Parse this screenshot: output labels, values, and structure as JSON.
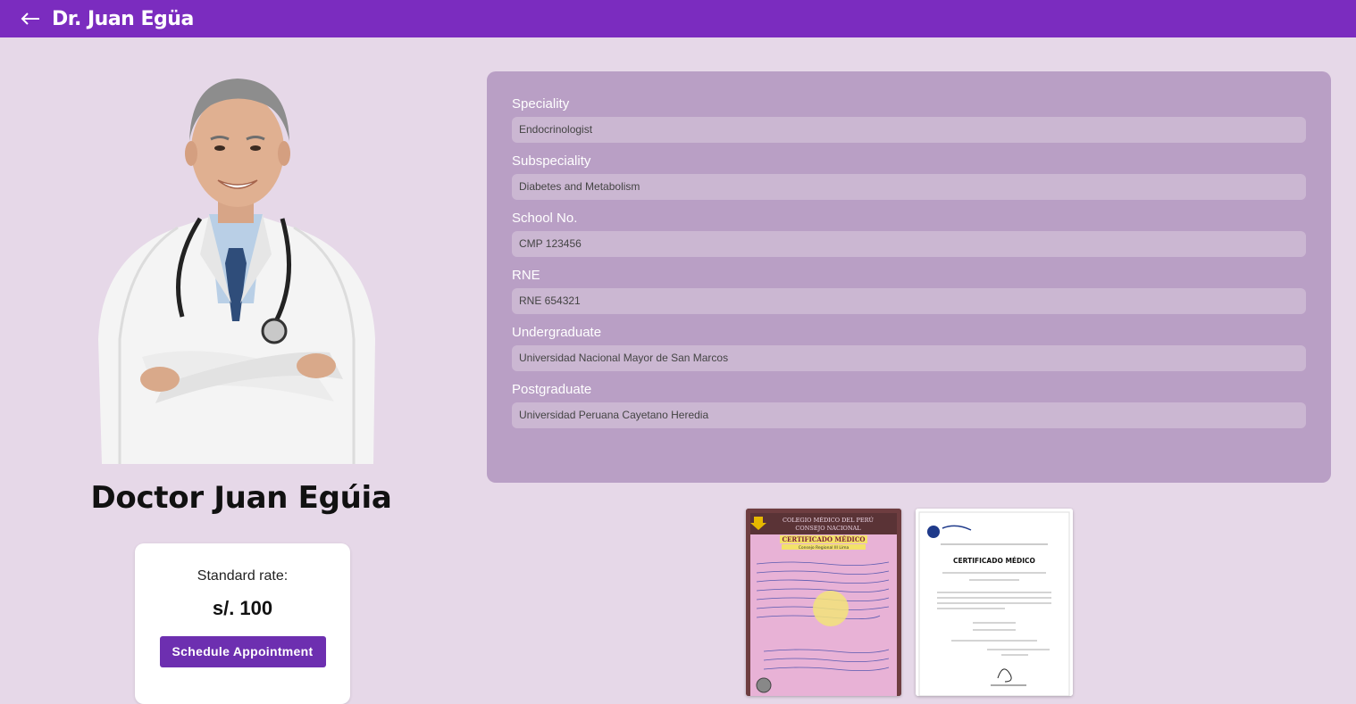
{
  "header": {
    "back_icon": "arrow-left-icon",
    "title": "Dr. Juan Egüa"
  },
  "profile": {
    "name": "Doctor Juan Egúia",
    "rate_label": "Standard rate:",
    "rate_value": "s/. 100",
    "schedule_button": "Schedule Appointment"
  },
  "details": {
    "fields": [
      {
        "label": "Speciality",
        "value": "Endocrinologist"
      },
      {
        "label": "Subspeciality",
        "value": "Diabetes and Metabolism"
      },
      {
        "label": "School No.",
        "value": "CMP 123456"
      },
      {
        "label": "RNE",
        "value": "RNE 654321"
      },
      {
        "label": "Undergraduate",
        "value": "Universidad Nacional Mayor de San Marcos"
      },
      {
        "label": "Postgraduate",
        "value": "Universidad Peruana Cayetano Heredia"
      }
    ]
  },
  "certificates": [
    {
      "heading": "COLEGIO MÉDICO DEL PERÚ",
      "subheading": "CONSEJO NACIONAL",
      "title": "CERTIFICADO MÉDICO",
      "region": "Consejo Regional III Lima"
    },
    {
      "heading": "CERTIFICADO MÉDICO"
    }
  ],
  "colors": {
    "topbar": "#7b2cbf",
    "background": "#e6d8e8",
    "panel": "#b99fc5",
    "field": "#cbb7d2",
    "button": "#6d2fb0"
  }
}
